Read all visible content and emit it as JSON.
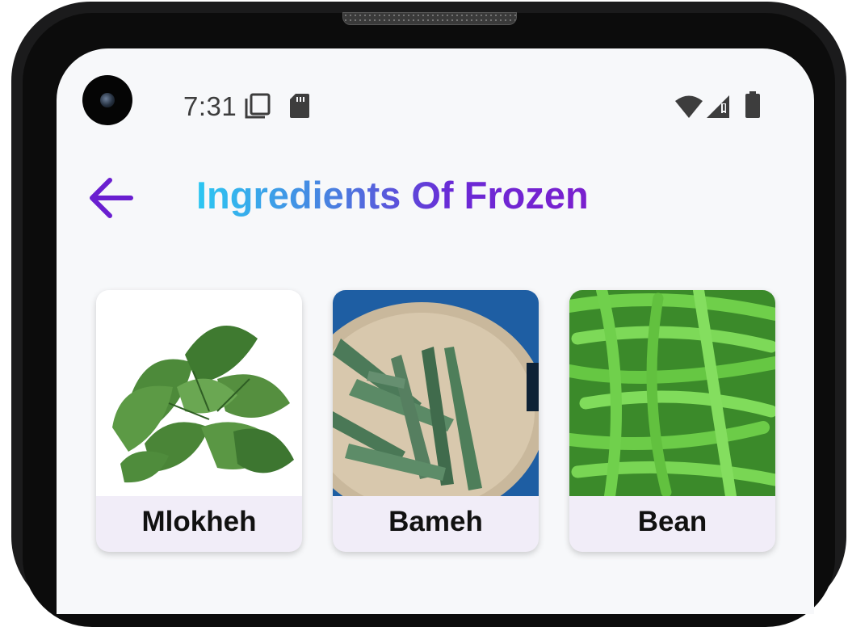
{
  "status_bar": {
    "time": "7:31",
    "left_icons": [
      "screen-icon",
      "sd-card-icon"
    ],
    "right_icons": [
      "wifi-icon",
      "signal-icon",
      "battery-icon"
    ]
  },
  "header": {
    "back_icon": "arrow-left-icon",
    "title": "Ingredients Of Frozen"
  },
  "colors": {
    "title_gradient": [
      "#2cc7f2",
      "#7a1fce"
    ],
    "back_arrow": "#6a1fd0",
    "card_label_bg": "#f1edf8",
    "screen_bg": "#f7f8fa"
  },
  "items": [
    {
      "label": "Mlokheh",
      "image": "mlokheh-leaves-image"
    },
    {
      "label": "Bameh",
      "image": "okra-plate-image"
    },
    {
      "label": "Bean",
      "image": "green-beans-image"
    }
  ]
}
